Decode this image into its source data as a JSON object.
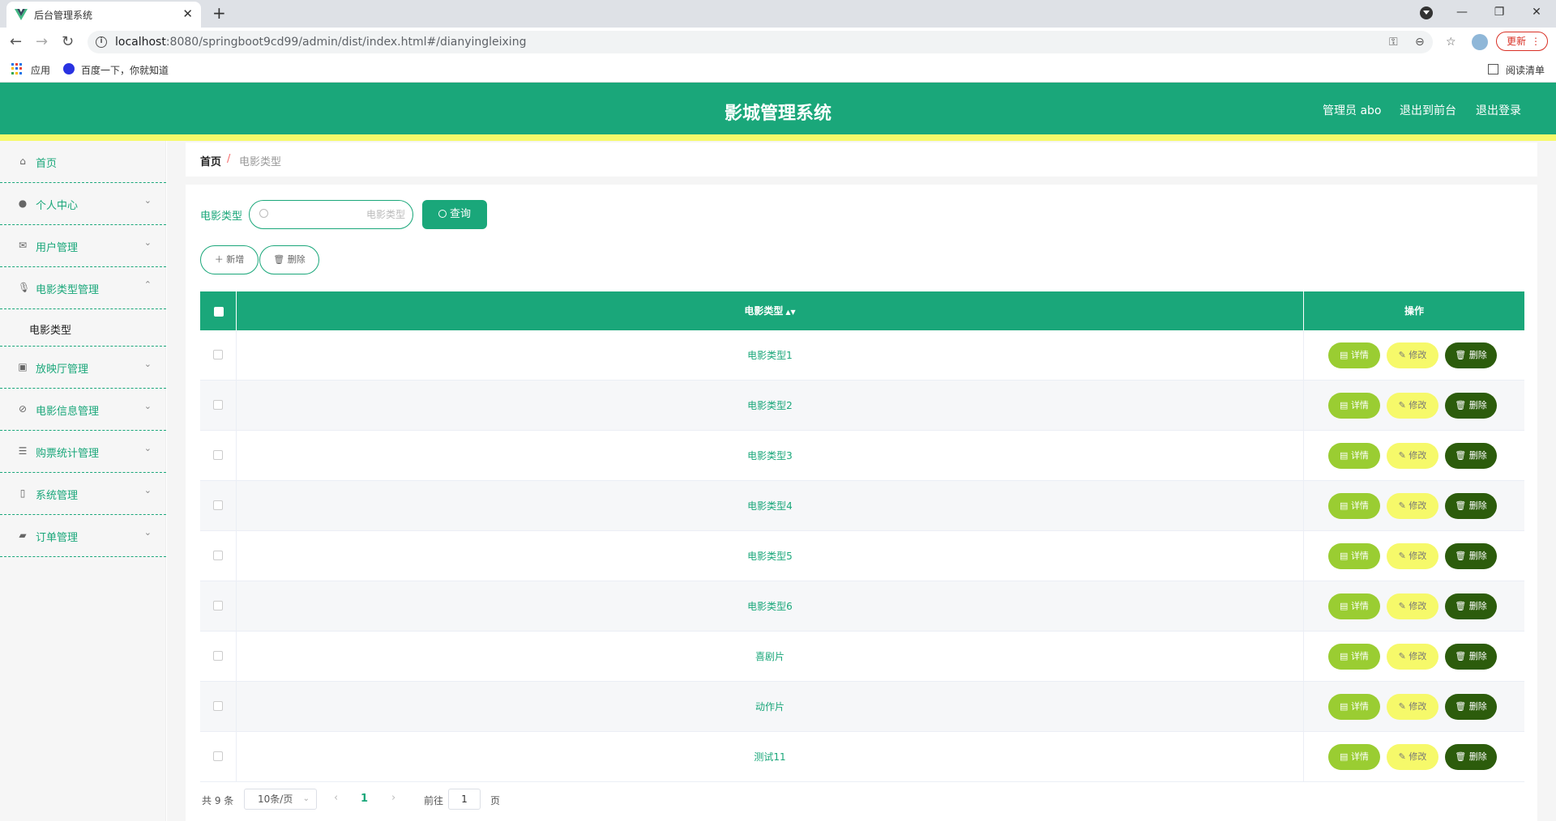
{
  "browser": {
    "tab_title": "后台管理系统",
    "url_host": "localhost",
    "url_path": ":8080/springboot9cd99/admin/dist/index.html#/dianyingleixing",
    "update_label": "更新",
    "bookmarks": [
      "应用",
      "百度一下，你就知道"
    ],
    "reading_list": "阅读清单"
  },
  "header": {
    "title": "影城管理系统",
    "admin_label": "管理员 abo",
    "back_front": "退出到前台",
    "logout": "退出登录"
  },
  "sidebar": {
    "items": [
      {
        "label": "首页",
        "icon": "home-icon"
      },
      {
        "label": "个人中心",
        "icon": "user-icon"
      },
      {
        "label": "用户管理",
        "icon": "mail-icon"
      },
      {
        "label": "电影类型管理",
        "icon": "microphone-icon"
      },
      {
        "label": "电影类型",
        "icon": ""
      },
      {
        "label": "放映厅管理",
        "icon": "clipboard-icon"
      },
      {
        "label": "电影信息管理",
        "icon": "compass-icon"
      },
      {
        "label": "购票统计管理",
        "icon": "sliders-icon"
      },
      {
        "label": "系统管理",
        "icon": "tablet-icon"
      },
      {
        "label": "订单管理",
        "icon": "camera-icon"
      }
    ]
  },
  "breadcrumb": {
    "home": "首页",
    "separator": "/",
    "current": "电影类型"
  },
  "search": {
    "label": "电影类型",
    "placeholder": "电影类型",
    "button": "查询"
  },
  "actions": {
    "add": "新增",
    "delete": "删除"
  },
  "table": {
    "header_type": "电影类型",
    "header_op": "操作",
    "rows": [
      "电影类型1",
      "电影类型2",
      "电影类型3",
      "电影类型4",
      "电影类型5",
      "电影类型6",
      "喜剧片",
      "动作片",
      "测试11"
    ],
    "detail_label": "详情",
    "edit_label": "修改",
    "delete_label": "删除"
  },
  "pagination": {
    "total": "共 9 条",
    "page_size": "10条/页",
    "current_page": "1",
    "goto_label": "前往",
    "goto_value": "1",
    "page_suffix": "页"
  },
  "colors": {
    "primary": "#1aa77a",
    "accent_yellow": "#f6f96a",
    "detail": "#9acd32",
    "delete": "#2c5c0c"
  }
}
